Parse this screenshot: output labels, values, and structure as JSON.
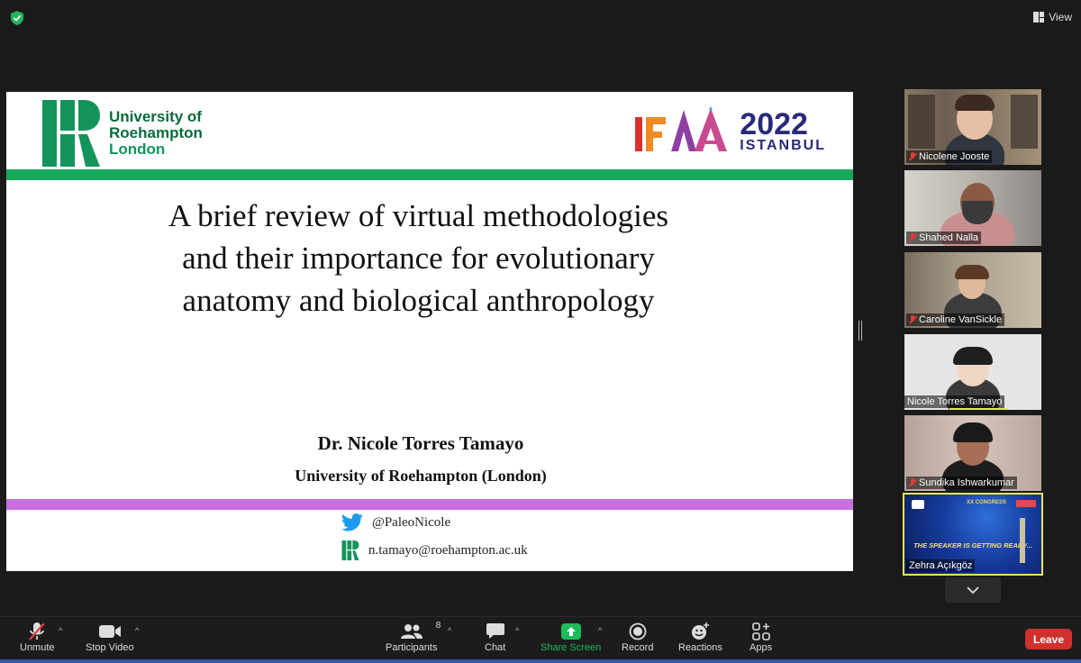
{
  "topbar": {
    "view_label": "View",
    "shield_icon": "shield-check-icon",
    "shield_color": "#26b35a"
  },
  "slide": {
    "university_logo_line1": "University of",
    "university_logo_line2": "Roehampton",
    "university_logo_line3": "London",
    "conference_logo_letters": "IFAA",
    "conference_logo_year": "2022",
    "conference_logo_city": "ISTANBUL",
    "title": "A brief review of virtual methodologies and their importance for evolutionary anatomy and biological anthropology",
    "author": "Dr. Nicole Torres Tamayo",
    "affiliation": "University of Roehampton (London)",
    "twitter_handle": "@PaleoNicole",
    "email": "n.tamayo@roehampton.ac.uk",
    "colors": {
      "green_bar": "#17a95b",
      "purple_bar": "#c770e0",
      "uni_green": "#0a6b3a"
    }
  },
  "participants": [
    {
      "name": "Nicolene Jooste",
      "muted": true
    },
    {
      "name": "Shahed Nalla",
      "muted": true
    },
    {
      "name": "Caroline VanSickle",
      "muted": true
    },
    {
      "name": "Nicole Torres Tamayo",
      "muted": false,
      "active_speaker": true
    },
    {
      "name": "Sundika Ishwarkumar",
      "muted": true
    },
    {
      "name": "Zehra Açıkgöz",
      "muted": false,
      "spotlight": true
    }
  ],
  "zehra_tile_text": {
    "headline": "THE SPEAKER IS GETTING READY..."
  },
  "toolbar": {
    "unmute": "Unmute",
    "stop_video": "Stop Video",
    "participants": "Participants",
    "participants_count": "8",
    "chat": "Chat",
    "share_screen": "Share Screen",
    "record": "Record",
    "reactions": "Reactions",
    "apps": "Apps",
    "leave": "Leave",
    "share_color": "#1dbc5a",
    "leave_color": "#d0312d"
  }
}
